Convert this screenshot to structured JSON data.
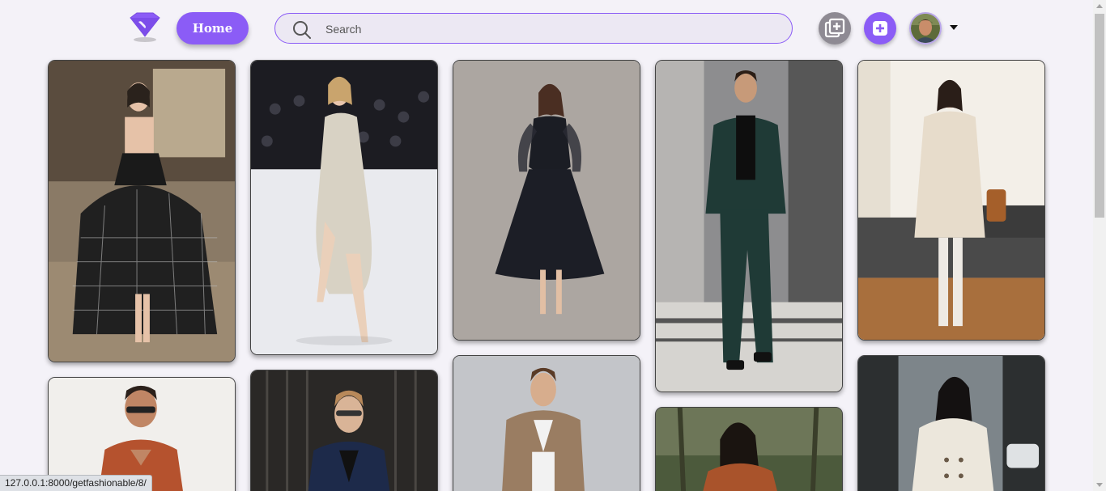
{
  "header": {
    "logo_icon": "diamond-logo-icon",
    "home_label": "Home",
    "search": {
      "placeholder": "Search",
      "value": "",
      "icon": "search-icon"
    },
    "collection_icon": "add-collection-icon",
    "create_icon": "add-pin-icon",
    "avatar_icon": "user-avatar",
    "menu_icon": "caret-down-icon",
    "accent_color": "#8b5cf6"
  },
  "pins": [
    {
      "name": "pin-black-checkered-gown",
      "icon": "fashion-photo"
    },
    {
      "name": "pin-silver-slip-dress-runway",
      "icon": "fashion-photo"
    },
    {
      "name": "pin-black-tulle-midi-dress",
      "icon": "fashion-photo"
    },
    {
      "name": "pin-green-suit-man",
      "icon": "fashion-photo"
    },
    {
      "name": "pin-cream-coat-woman",
      "icon": "fashion-photo"
    },
    {
      "name": "pin-rust-shirt-man",
      "icon": "fashion-photo"
    },
    {
      "name": "pin-navy-pinstripe-suit",
      "icon": "fashion-photo"
    },
    {
      "name": "pin-beige-double-breasted-blazer",
      "icon": "fashion-photo"
    },
    {
      "name": "pin-brown-turtleneck-woman",
      "icon": "fashion-photo"
    },
    {
      "name": "pin-white-wool-coat-woman",
      "icon": "fashion-photo"
    }
  ],
  "status_bar": {
    "url": "127.0.0.1:8000/getfashionable/8/"
  }
}
